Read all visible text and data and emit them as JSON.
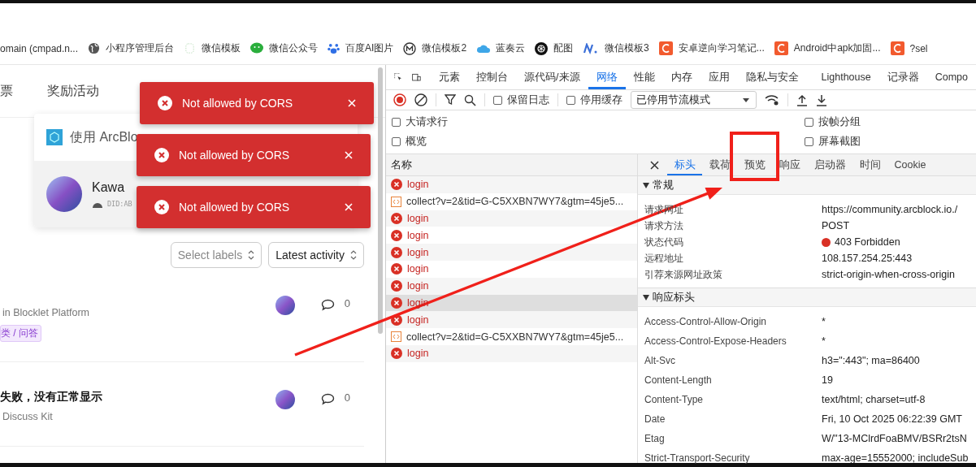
{
  "bookmarks": [
    {
      "label": "omain (cmpad.n...",
      "kind": "none"
    },
    {
      "label": "小程序管理后台",
      "kind": "globe"
    },
    {
      "label": "微信模板",
      "kind": "dots"
    },
    {
      "label": "微信公众号",
      "kind": "chat"
    },
    {
      "label": "百度AI图片",
      "kind": "paw"
    },
    {
      "label": "微信模板2",
      "kind": "m"
    },
    {
      "label": "蓝奏云",
      "kind": "cloud"
    },
    {
      "label": "配图",
      "kind": "knot"
    },
    {
      "label": "微信模板3",
      "kind": "n"
    },
    {
      "label": "安卓逆向学习笔记...",
      "kind": "c"
    },
    {
      "label": "Android中apk加固...",
      "kind": "c"
    },
    {
      "label": "?sel",
      "kind": "c"
    }
  ],
  "page": {
    "nav": [
      "票",
      "奖励活动"
    ],
    "login_card": {
      "title": "使用 ArcBlo",
      "user_name": "Kawa",
      "did": "DID:AB"
    },
    "toasts": [
      {
        "message": "Not allowed by CORS"
      },
      {
        "message": "Not allowed by CORS"
      },
      {
        "message": "Not allowed by CORS"
      }
    ],
    "filters": [
      {
        "label": "Select labels",
        "placeholder": true
      },
      {
        "label": "Latest activity",
        "placeholder": false
      }
    ],
    "posts": [
      {
        "meta": "in Blocklet Platform",
        "tag": "类 / 问答",
        "comments": "0"
      },
      {
        "title": "失败，没有正常显示",
        "meta": "Discuss Kit",
        "comments": "0"
      }
    ]
  },
  "devtools": {
    "panel_tabs": [
      {
        "label": "元素",
        "selected": false
      },
      {
        "label": "控制台",
        "selected": false
      },
      {
        "label": "源代码/来源",
        "selected": false
      },
      {
        "label": "网络",
        "selected": true
      },
      {
        "label": "性能",
        "selected": false
      },
      {
        "label": "内存",
        "selected": false
      },
      {
        "label": "应用",
        "selected": false
      },
      {
        "label": "隐私与安全",
        "selected": false
      },
      {
        "label": "Lighthouse",
        "selected": false
      },
      {
        "label": "记录器",
        "selected": false
      },
      {
        "label": "Compo",
        "selected": false
      }
    ],
    "toolbar": {
      "preserve_log": {
        "label": "保留日志",
        "checked": false
      },
      "disable_cache": {
        "label": "停用缓存",
        "checked": false
      },
      "throttling": "已停用节流模式"
    },
    "options": [
      {
        "label": "大请求行",
        "checked": false
      },
      {
        "label": "按帧分组",
        "checked": false
      },
      {
        "label": "概览",
        "checked": false
      },
      {
        "label": "屏幕截图",
        "checked": false
      }
    ],
    "requests": {
      "column": "名称",
      "rows": [
        {
          "name": "login",
          "kind": "error",
          "selected": false
        },
        {
          "name": "collect?v=2&tid=G-C5XXBN7WY7&gtm=45je5...",
          "kind": "script",
          "selected": false
        },
        {
          "name": "login",
          "kind": "error",
          "selected": false
        },
        {
          "name": "login",
          "kind": "error",
          "selected": false
        },
        {
          "name": "login",
          "kind": "error",
          "selected": false
        },
        {
          "name": "login",
          "kind": "error",
          "selected": false
        },
        {
          "name": "login",
          "kind": "error",
          "selected": false
        },
        {
          "name": "login",
          "kind": "error",
          "selected": true
        },
        {
          "name": "login",
          "kind": "error",
          "selected": false
        },
        {
          "name": "collect?v=2&tid=G-C5XXBN7WY7&gtm=45je5...",
          "kind": "script",
          "selected": false
        },
        {
          "name": "login",
          "kind": "error",
          "selected": false
        }
      ]
    },
    "detail_tabs": [
      {
        "label": "标头",
        "selected": true
      },
      {
        "label": "载荷",
        "selected": false
      },
      {
        "label": "预览",
        "selected": false
      },
      {
        "label": "响应",
        "selected": false
      },
      {
        "label": "启动器",
        "selected": false
      },
      {
        "label": "时间",
        "selected": false
      },
      {
        "label": "Cookie",
        "selected": false
      }
    ],
    "sections": [
      {
        "title": "常规",
        "expanded": true,
        "kind": "general",
        "rows": [
          {
            "label": "请求网址",
            "value": "https://community.arcblock.io./"
          },
          {
            "label": "请求方法",
            "value": "POST"
          },
          {
            "label": "状态代码",
            "value": "403 Forbidden",
            "color": "#d93025"
          },
          {
            "label": "远程地址",
            "value": "108.157.254.25:443"
          },
          {
            "label": "引荐来源网址政策",
            "value": "strict-origin-when-cross-origin"
          }
        ]
      },
      {
        "title": "响应标头",
        "expanded": true,
        "kind": "headers",
        "rows": [
          {
            "label": "Access-Control-Allow-Origin",
            "value": "*"
          },
          {
            "label": "Access-Control-Expose-Headers",
            "value": "*"
          },
          {
            "label": "Alt-Svc",
            "value": "h3=\":443\"; ma=86400"
          },
          {
            "label": "Content-Length",
            "value": "19"
          },
          {
            "label": "Content-Type",
            "value": "text/html; charset=utf-8"
          },
          {
            "label": "Date",
            "value": "Fri, 10 Oct 2025 06:22:39 GMT"
          },
          {
            "label": "Etag",
            "value": "W/\"13-MClrdFoaBMV/BSRr2tsN"
          },
          {
            "label": "Strict-Transport-Security",
            "value": "max-age=15552000; includeSub"
          }
        ]
      }
    ]
  },
  "annotations": {
    "kind": "arrow-to-box"
  }
}
